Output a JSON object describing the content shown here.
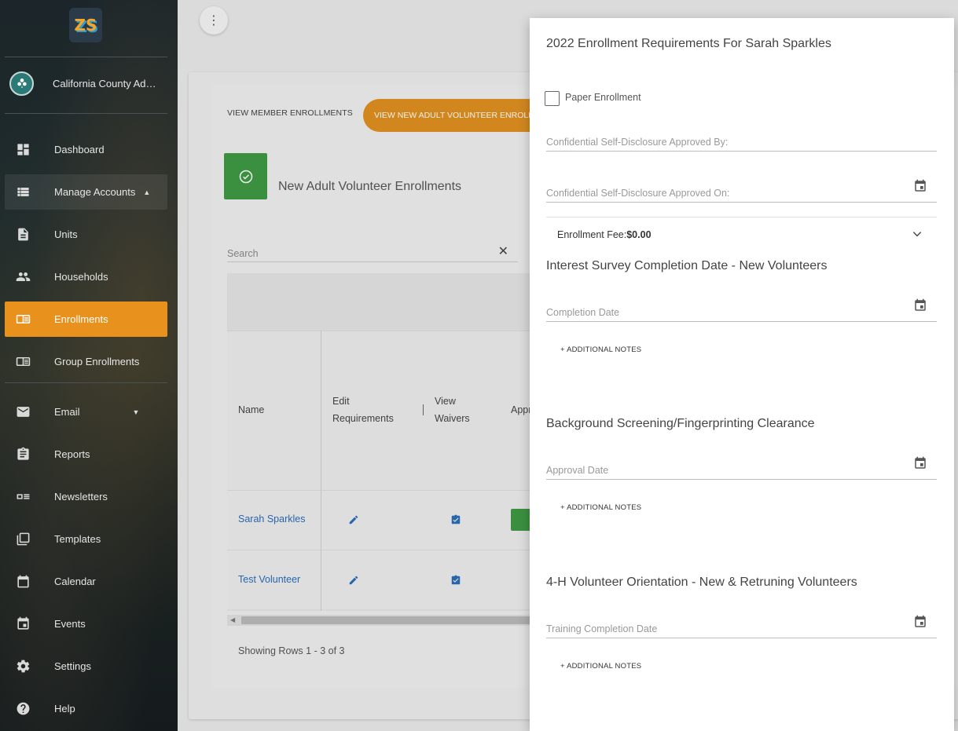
{
  "sidebar": {
    "logo_text": "ZS",
    "profile_name": "California County Administrator",
    "items": [
      {
        "label": "Dashboard",
        "icon": "dashboard-icon"
      },
      {
        "label": "Manage Accounts",
        "icon": "list-icon"
      },
      {
        "label": "Units",
        "icon": "document-icon"
      },
      {
        "label": "Households",
        "icon": "people-icon"
      },
      {
        "label": "Enrollments",
        "icon": "enrollment-icon"
      },
      {
        "label": "Group Enrollments",
        "icon": "group-enrollment-icon"
      },
      {
        "label": "Email",
        "icon": "email-icon"
      },
      {
        "label": "Reports",
        "icon": "clipboard-icon"
      },
      {
        "label": "Newsletters",
        "icon": "newsletter-icon"
      },
      {
        "label": "Templates",
        "icon": "templates-icon"
      },
      {
        "label": "Calendar",
        "icon": "calendar-icon"
      },
      {
        "label": "Events",
        "icon": "event-icon"
      },
      {
        "label": "Settings",
        "icon": "gear-icon"
      },
      {
        "label": "Help",
        "icon": "help-icon"
      }
    ]
  },
  "main": {
    "tabs": [
      "VIEW MEMBER ENROLLMENTS",
      "VIEW NEW ADULT VOLUNTEER ENROLLMENTS"
    ],
    "page_title": "New Adult Volunteer Enrollments",
    "search_placeholder": "Search",
    "columns": {
      "name": "Name",
      "edit_1": "Edit",
      "edit_2": "Requirements",
      "view_1": "View",
      "view_2": "Waivers",
      "approve": "Approve"
    },
    "rows": [
      {
        "name": "Sarah Sparkles"
      },
      {
        "name": "Test Volunteer"
      }
    ],
    "showing": "Showing Rows 1 - 3 of 3"
  },
  "dialog": {
    "title": "2022 Enrollment Requirements For Sarah Sparkles",
    "paper_enrollment_label": "Paper Enrollment",
    "approved_by_label": "Confidential Self-Disclosure Approved By:",
    "approved_on_label": "Confidential Self-Disclosure Approved On:",
    "fee_label": "Enrollment Fee:",
    "fee_value": "$0.00",
    "sections": [
      {
        "title": "Interest Survey Completion Date - New Volunteers",
        "field_label": "Completion Date",
        "notes": "+ ADDITIONAL NOTES"
      },
      {
        "title": "Background Screening/Fingerprinting Clearance",
        "field_label": "Approval Date",
        "notes": "+ ADDITIONAL NOTES"
      },
      {
        "title": "4-H Volunteer Orientation - New & Retruning Volunteers",
        "field_label": "Training Completion Date",
        "notes": "+ ADDITIONAL NOTES"
      }
    ]
  },
  "colors": {
    "accent_orange": "#e8911d",
    "approve_green": "#3f9a45",
    "link_blue": "#2a6cb8"
  }
}
